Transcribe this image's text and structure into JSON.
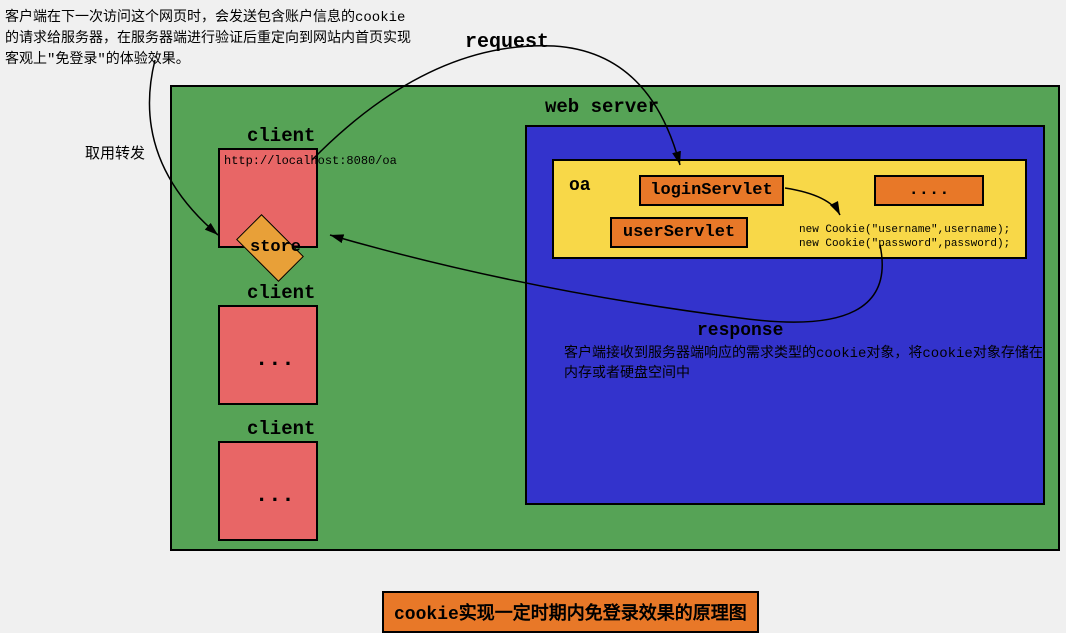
{
  "top_description": "客户端在下一次访问这个网页时，会发送包含账户信息的cookie的请求给服务器，在服务器端进行验证后重定向到网站内首页实现客观上\"免登录\"的体验效果。",
  "request_label": "request",
  "forward_label": "取用转发",
  "client": {
    "label": "client",
    "url": "http://localhost:8080/oa",
    "store": "store",
    "dots": "..."
  },
  "webserver": {
    "label": "web server",
    "oa_label": "oa",
    "loginServlet": "loginServlet",
    "userServlet": "userServlet",
    "dotsServlet": "....",
    "cookie_code1": "new Cookie(\"username\",username);",
    "cookie_code2": "new Cookie(\"password\",password);",
    "response_label": "response",
    "response_desc": "客户端接收到服务器端响应的需求类型的cookie对象，将cookie对象存储在内存或者硬盘空间中"
  },
  "caption": "cookie实现一定时期内免登录效果的原理图"
}
